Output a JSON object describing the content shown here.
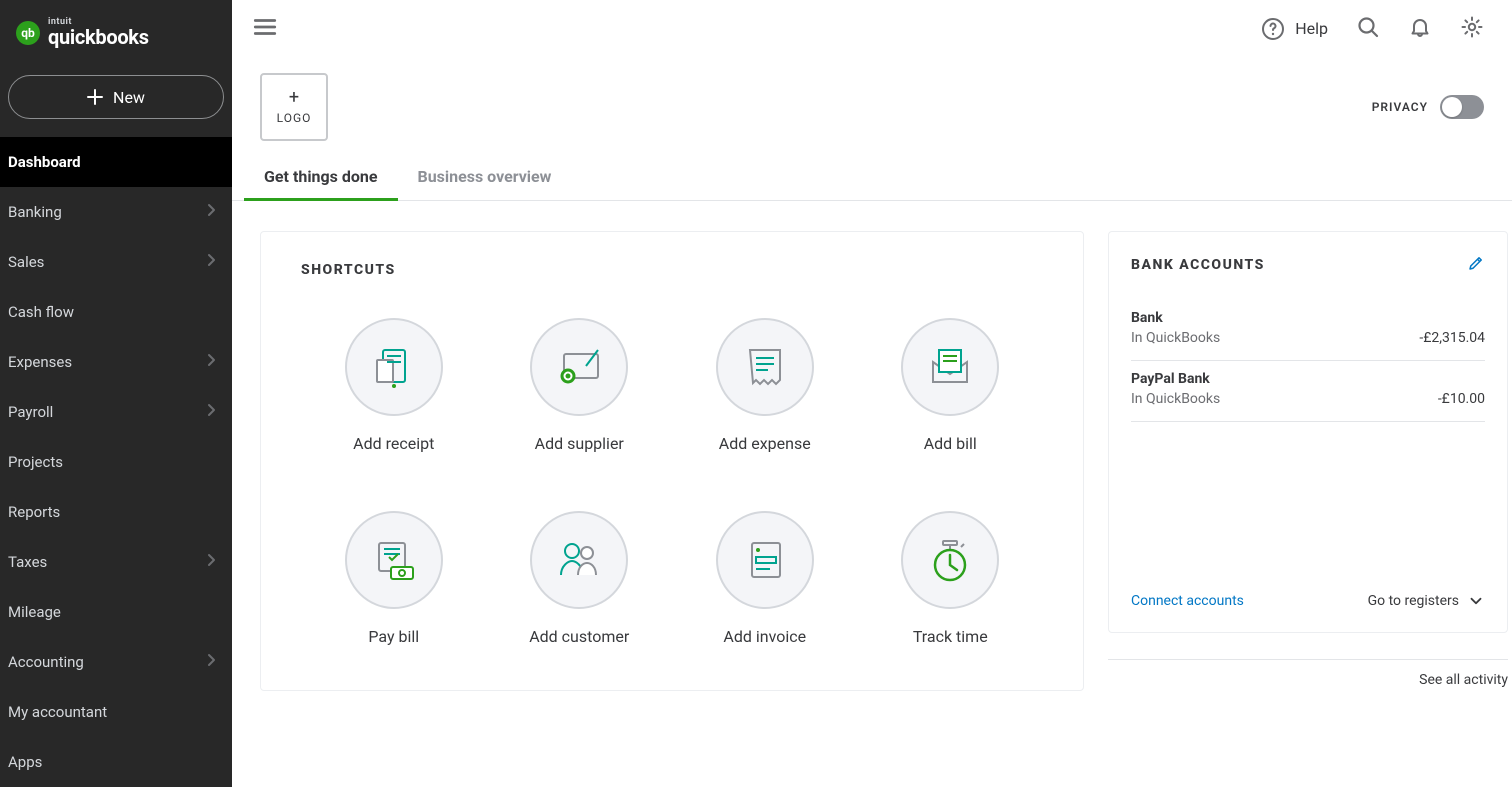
{
  "brand": {
    "intuit": "intuit",
    "name": "quickbooks",
    "logo_abbr": "qb"
  },
  "sidebar": {
    "new_label": "New",
    "items": [
      {
        "label": "Dashboard",
        "chevron": false,
        "active": true
      },
      {
        "label": "Banking",
        "chevron": true
      },
      {
        "label": "Sales",
        "chevron": true
      },
      {
        "label": "Cash flow",
        "chevron": false
      },
      {
        "label": "Expenses",
        "chevron": true
      },
      {
        "label": "Payroll",
        "chevron": true
      },
      {
        "label": "Projects",
        "chevron": false
      },
      {
        "label": "Reports",
        "chevron": false
      },
      {
        "label": "Taxes",
        "chevron": true
      },
      {
        "label": "Mileage",
        "chevron": false
      },
      {
        "label": "Accounting",
        "chevron": true
      },
      {
        "label": "My accountant",
        "chevron": false
      },
      {
        "label": "Apps",
        "chevron": false
      }
    ]
  },
  "topbar": {
    "help_label": "Help"
  },
  "logo_box": {
    "plus": "+",
    "label": "LOGO"
  },
  "privacy": {
    "label": "PRIVACY"
  },
  "tabs": [
    {
      "label": "Get things done",
      "active": true
    },
    {
      "label": "Business overview",
      "active": false
    }
  ],
  "shortcuts": {
    "title": "SHORTCUTS",
    "items": [
      {
        "label": "Add receipt",
        "icon": "receipt-icon"
      },
      {
        "label": "Add supplier",
        "icon": "supplier-icon"
      },
      {
        "label": "Add expense",
        "icon": "expense-icon"
      },
      {
        "label": "Add bill",
        "icon": "bill-icon"
      },
      {
        "label": "Pay bill",
        "icon": "pay-bill-icon"
      },
      {
        "label": "Add customer",
        "icon": "customer-icon"
      },
      {
        "label": "Add invoice",
        "icon": "invoice-icon"
      },
      {
        "label": "Track time",
        "icon": "track-time-icon"
      }
    ]
  },
  "bank": {
    "title": "BANK ACCOUNTS",
    "in_qb_label": "In QuickBooks",
    "accounts": [
      {
        "name": "Bank",
        "balance": "-£2,315.04"
      },
      {
        "name": "PayPal Bank",
        "balance": "-£10.00"
      }
    ],
    "connect_label": "Connect accounts",
    "registers_label": "Go to registers"
  },
  "footer": {
    "see_all": "See all activity"
  }
}
